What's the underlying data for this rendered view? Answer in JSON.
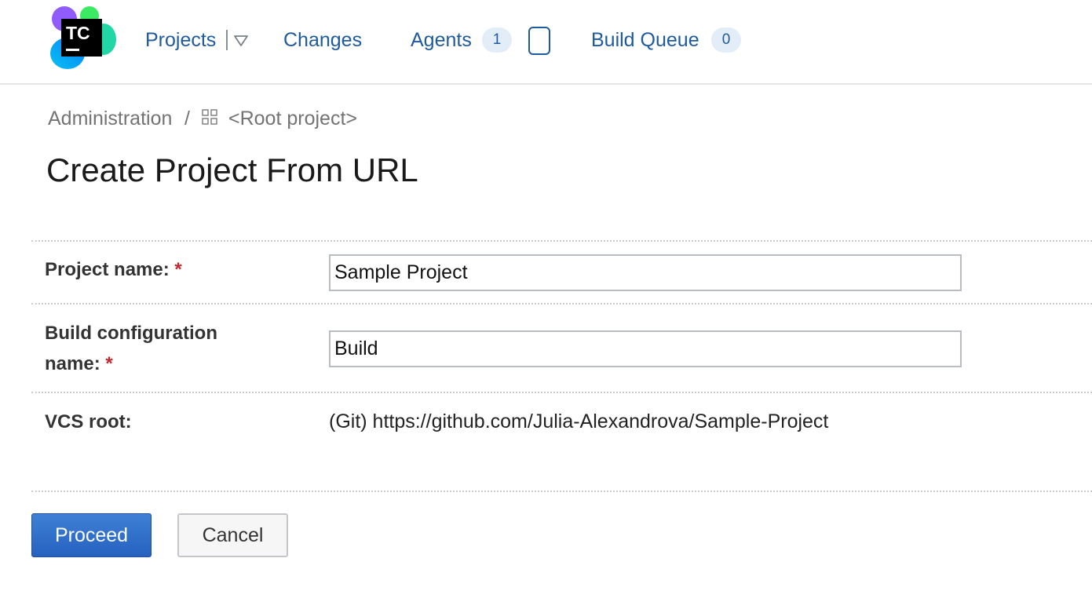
{
  "header": {
    "logo_text": "TC",
    "nav": {
      "projects": "Projects",
      "changes": "Changes",
      "agents": "Agents",
      "agents_count": "1",
      "build_queue": "Build Queue",
      "build_queue_count": "0"
    }
  },
  "breadcrumb": {
    "administration": "Administration",
    "separator": "/",
    "root_project": "<Root project>"
  },
  "page": {
    "title": "Create Project From URL"
  },
  "form": {
    "project_name": {
      "label": "Project name:",
      "required_mark": "*",
      "value": "Sample Project"
    },
    "build_config_name": {
      "label_line1": "Build configuration",
      "label_line2": "name:",
      "required_mark": "*",
      "value": "Build"
    },
    "vcs_root": {
      "label": "VCS root:",
      "value": "(Git) https://github.com/Julia-Alexandrova/Sample-Project"
    }
  },
  "buttons": {
    "proceed": "Proceed",
    "cancel": "Cancel"
  },
  "colors": {
    "link": "#1e5a9e",
    "badge_bg": "#e3edf8",
    "required": "#c0262d",
    "primary_button": "#2c6bcb"
  },
  "icons": {
    "logo": "teamcity-logo-icon",
    "projects_dropdown": "caret-down-icon",
    "agents": "agent-device-icon",
    "root_project": "grid-icon"
  }
}
